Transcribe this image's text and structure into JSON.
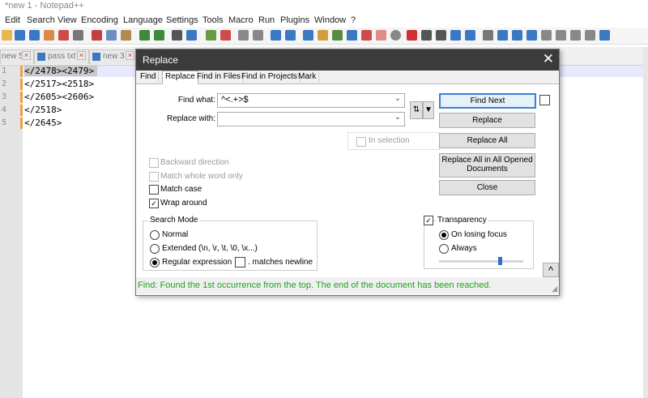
{
  "window": {
    "title": "*new 1 - Notepad++"
  },
  "menu": [
    "Edit",
    "Search",
    "View",
    "Encoding",
    "Language",
    "Settings",
    "Tools",
    "Macro",
    "Run",
    "Plugins",
    "Window",
    "?"
  ],
  "tabs": [
    {
      "label": "new 5"
    },
    {
      "label": "pass txt"
    },
    {
      "label": "new 3"
    }
  ],
  "editor": {
    "line_numbers": [
      "1",
      "2",
      "3",
      "4",
      "5"
    ],
    "lines": [
      "</2478><2479>",
      "</2517><2518>",
      "</2605><2606>",
      "</2518>",
      "</2645>"
    ]
  },
  "dialog": {
    "title": "Replace",
    "tabs": [
      "Find",
      "Replace",
      "Find in Files",
      "Find in Projects",
      "Mark"
    ],
    "find_what_label": "Find what:",
    "find_what_value": "^<.+>$",
    "replace_with_label": "Replace with:",
    "replace_with_value": "",
    "in_selection_label": "In selection",
    "buttons": {
      "find_next": "Find Next",
      "replace": "Replace",
      "replace_all": "Replace All",
      "replace_all_opened_l1": "Replace All in All Opened",
      "replace_all_opened_l2": "Documents",
      "close": "Close",
      "collapse": "^"
    },
    "options": {
      "backward": "Backward direction",
      "whole_word": "Match whole word only",
      "match_case": "Match case",
      "wrap_around": "Wrap around"
    },
    "search_mode": {
      "title": "Search Mode",
      "normal": "Normal",
      "extended": "Extended (\\n, \\r, \\t, \\0, \\x...)",
      "regex": "Regular expression",
      "matches_newline": ". matches newline",
      "selected": "regex"
    },
    "transparency": {
      "label": "Transparency",
      "on_losing_focus": "On losing focus",
      "always": "Always",
      "selected": "on_losing_focus",
      "level": 0.72
    },
    "status": "Find: Found the 1st occurrence from the top. The end of the document has been reached.",
    "colors": {
      "title_bar": "#3b3b3b",
      "status_text": "#1fa31f",
      "accent": "#3b7fd6"
    }
  }
}
